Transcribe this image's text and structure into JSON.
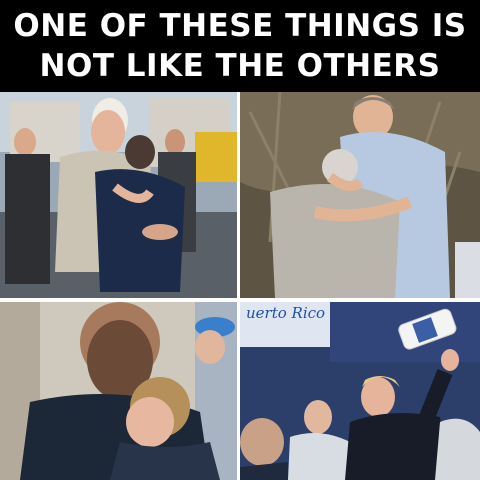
{
  "meme": {
    "caption_line_1": "ONE OF THESE THINGS IS",
    "caption_line_2": "NOT LIKE THE OTHERS"
  },
  "panels": [
    {
      "id": "panel-1",
      "subject": "man in grey sweater hugging a woman outdoors"
    },
    {
      "id": "panel-2",
      "subject": "man in blue shirt hugging a grey-haired man"
    },
    {
      "id": "panel-3",
      "subject": "man in dark jacket hugging a woman"
    },
    {
      "id": "panel-4",
      "subject": "man in dark jacket tossing a paper towel roll",
      "sign_text": "uerto Rico"
    }
  ],
  "colors": {
    "header_bg": "#000000",
    "header_text": "#ffffff",
    "sign_text": "#1f4fa8"
  }
}
